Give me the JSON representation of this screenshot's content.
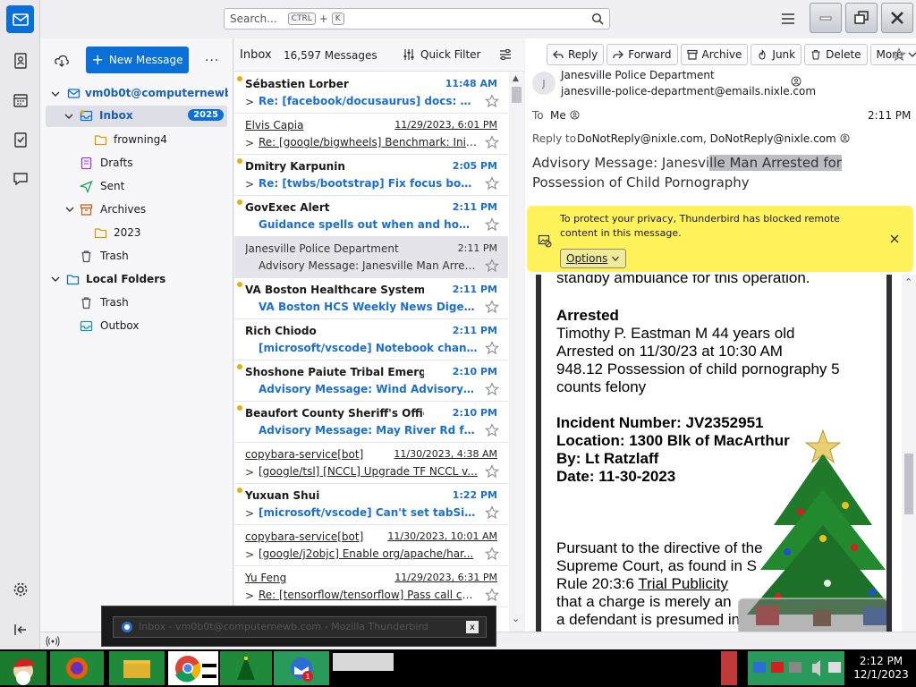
{
  "search": {
    "placeholder": "Search...",
    "key1": "CTRL",
    "plus": "+",
    "key2": "K"
  },
  "folder_pane": {
    "new_message": "New Message",
    "more": "...",
    "account": "vm0b0t@computernewb....",
    "folders": [
      {
        "label": "Inbox",
        "badge": "2025"
      },
      {
        "label": "frowning4"
      },
      {
        "label": "Drafts"
      },
      {
        "label": "Sent"
      },
      {
        "label": "Archives"
      },
      {
        "label": "2023"
      },
      {
        "label": "Trash"
      },
      {
        "label": "Local Folders"
      },
      {
        "label": "Trash"
      },
      {
        "label": "Outbox"
      }
    ]
  },
  "list": {
    "folder": "Inbox",
    "count": "16,597 Messages",
    "quick_filter": "Quick Filter",
    "messages": [
      {
        "from": "Sébastien Lorber",
        "date": "11:48 AM",
        "subject": "Re: [facebook/docusaurus] docs: add ...",
        "state": "unread",
        "dot": true,
        "chev": ">"
      },
      {
        "from": "Elvis Capia",
        "date": "11/29/2023, 6:01 PM",
        "subject": "Re: [google/bigwheels] Benchmark: Initi...",
        "state": "read",
        "dot": false,
        "chev": ">"
      },
      {
        "from": "Dmitry Karpunin",
        "date": "2:05 PM",
        "subject": "Re: [twbs/bootstrap] Fix focus box-s...",
        "state": "unread",
        "dot": true,
        "chev": ">"
      },
      {
        "from": "GovExec Alert",
        "date": "2:11 PM",
        "subject": "Guidance spells out when and how feds...",
        "state": "unread",
        "dot": true,
        "chev": ""
      },
      {
        "from": "Janesville Police Department",
        "date": "2:11 PM",
        "subject": "Advisory Message: Janesville Man Arreste...",
        "state": "plain",
        "dot": false,
        "chev": ""
      },
      {
        "from": "VA Boston Healthcare System",
        "date": "2:11 PM",
        "subject": "VA Boston HCS Weekly News Digest - D...",
        "state": "unread",
        "dot": true,
        "chev": ""
      },
      {
        "from": "Rich Chiodo",
        "date": "2:11 PM",
        "subject": "[microsoft/vscode] Notebook change e...",
        "state": "unread",
        "dot": false,
        "chev": ""
      },
      {
        "from": "Shoshone Paiute Tribal Emergency Resp...",
        "date": "2:10 PM",
        "subject": "Advisory Message: Wind Advisory until...",
        "state": "unread",
        "dot": true,
        "chev": ""
      },
      {
        "from": "Beaufort County Sheriff's Office",
        "date": "2:10 PM",
        "subject": "Advisory Message: May River Rd from B...",
        "state": "unread",
        "dot": true,
        "chev": ""
      },
      {
        "from": "copybara-service[bot]",
        "date": "11/30/2023, 4:38 AM",
        "subject": "[google/tsl] [NCCL] Upgrade TF NCCL v...",
        "state": "read",
        "dot": false,
        "chev": ">"
      },
      {
        "from": "Yuxuan Shui",
        "date": "1:22 PM",
        "subject": "[microsoft/vscode] Can't set tabSize ...",
        "state": "unread",
        "dot": true,
        "chev": ">"
      },
      {
        "from": "copybara-service[bot]",
        "date": "11/30/2023, 10:01 AM",
        "subject": "[google/j2objc] Enable org/apache/har...",
        "state": "read",
        "dot": false,
        "chev": ">"
      },
      {
        "from": "Yu Feng",
        "date": "11/29/2023, 6:31 PM",
        "subject": "Re: [tensorflow/tensorflow] Pass call con...",
        "state": "read",
        "dot": false,
        "chev": ">"
      }
    ]
  },
  "reader": {
    "toolbar": [
      "Reply",
      "Forward",
      "Archive",
      "Junk",
      "Delete",
      "More"
    ],
    "avatar": "J",
    "from_name": "Janesville Police Department",
    "from_addr": "janesville-police-department@emails.nixle.com",
    "to_label": "To",
    "to_value": "Me",
    "time": "2:11 PM",
    "reply_label": "Reply to",
    "reply_value": "DoNotReply@nixle.com, DoNotReply@nixle.com",
    "subject_a": "Advisory Message: Janesvi",
    "subject_hl": "lle Man Arrested for",
    "subject_b": " Possession of Child Pornography",
    "privacy_text": "To protect your privacy, Thunderbird has blocked remote content in this message.",
    "options": "Options",
    "body_lines": {
      "l0": "standby ambulance for this operation.",
      "l1": "Arrested",
      "l2": "Timothy P. Eastman M 44 years old",
      "l3": "Arrested on 11/30/23 at 10:30 AM",
      "l4": "948.12 Possession of child pornography 5",
      "l5": "counts felony",
      "l6": "Incident Number: JV2352951",
      "l7": "Location: 1300 Blk of MacArthur",
      "l8": "By: Lt Ratzlaff",
      "l9": "Date: 11-30-2023",
      "l10": "Pursuant to the directive of the",
      "l11": "Supreme Court, as found in S",
      "l12a": "Rule 20:3:6 ",
      "l12b": "Trial Publicity",
      "l13": "that a charge is merely an",
      "l14": "a defendant is presumed in"
    }
  },
  "tooltip": {
    "text": "Inbox - vm0b0t@computernewb.com - Mozilla Thunderbird",
    "close": "x"
  },
  "clock": {
    "time": "2:12 PM",
    "date": "12/1/2023"
  },
  "colors": {
    "accent": "#0a6fd6",
    "unread": "#1a6fd0",
    "privacy_bar": "#fff25a"
  }
}
